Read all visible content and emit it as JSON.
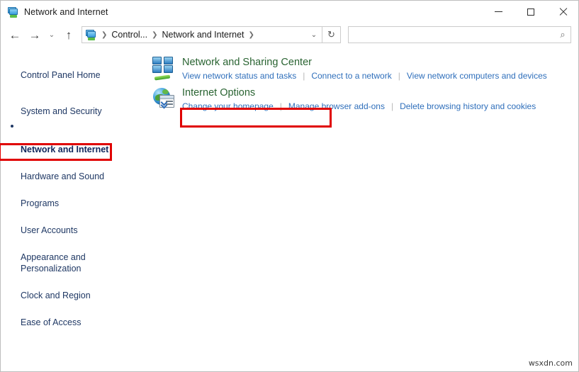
{
  "window": {
    "title": "Network and Internet",
    "title_icon": "control-panel-icon",
    "minimize_label": "—",
    "maximize_label": "□",
    "close_label": "✕"
  },
  "navbar": {
    "back_label": "←",
    "forward_label": "→",
    "recent_label": "⌄",
    "up_label": "↑",
    "breadcrumbs": [
      {
        "label": "Control..."
      },
      {
        "label": "Network and Internet"
      }
    ],
    "breadcrumb_separator": "❯",
    "address_chevron": "⌄",
    "refresh_label": "↻",
    "search": {
      "value": "",
      "placeholder": "",
      "icon": "⌕"
    }
  },
  "sidebar": {
    "items": [
      {
        "label": "Control Panel Home",
        "selected": false
      },
      {
        "label": "System and Security",
        "selected": false
      },
      {
        "label": "Network and Internet",
        "selected": true
      },
      {
        "label": "Hardware and Sound",
        "selected": false
      },
      {
        "label": "Programs",
        "selected": false
      },
      {
        "label": "User Accounts",
        "selected": false
      },
      {
        "label": "Appearance and\nPersonalization",
        "selected": false
      },
      {
        "label": "Clock and Region",
        "selected": false
      },
      {
        "label": "Ease of Access",
        "selected": false
      }
    ]
  },
  "main": {
    "categories": [
      {
        "icon": "network-sharing-center-icon",
        "title": "Network and Sharing Center",
        "highlighted": true,
        "links": [
          "View network status and tasks",
          "Connect to a network",
          "View network computers and devices"
        ]
      },
      {
        "icon": "internet-options-icon",
        "title": "Internet Options",
        "highlighted": false,
        "links": [
          "Change your homepage",
          "Manage browser add-ons",
          "Delete browsing history and cookies"
        ]
      }
    ]
  },
  "annotations": {
    "sidebar_box_target": "Network and Internet",
    "main_box_target": "Network and Sharing Center",
    "box_color": "#e00000"
  },
  "watermark": {
    "text": "wsxdn.com"
  },
  "colors": {
    "category_title": "#2a6432",
    "link": "#2f6fbb",
    "sidebar_text": "#1f3864",
    "annotation": "#e00000"
  }
}
